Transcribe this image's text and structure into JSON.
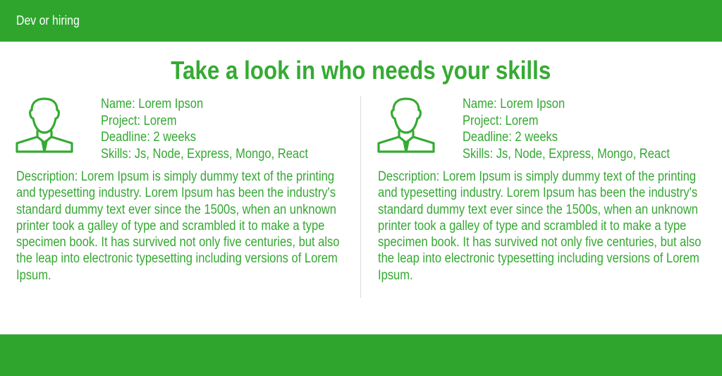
{
  "header": {
    "brand": "Dev or hiring"
  },
  "main": {
    "headline": "Take a look in who needs your skills",
    "cards": [
      {
        "icon": "user-avatar-icon",
        "name": "Name: Lorem Ipson",
        "project": "Project: Lorem",
        "deadline": "Deadline: 2 weeks",
        "skills": "Skills: Js, Node, Express, Mongo, React",
        "description": "Description:  Lorem Ipsum is simply dummy text of the printing and typesetting industry. Lorem Ipsum has been the industry's standard dummy text ever since the 1500s, when an unknown printer took a galley of type and scrambled it to make a type specimen book. It has survived not only five centuries, but also the leap into electronic typesetting including versions of Lorem Ipsum."
      },
      {
        "icon": "user-avatar-icon",
        "name": "Name: Lorem Ipson",
        "project": "Project: Lorem",
        "deadline": "Deadline: 2 weeks",
        "skills": "Skills: Js, Node, Express, Mongo, React",
        "description": "Description:  Lorem Ipsum is simply dummy text of the printing and typesetting industry. Lorem Ipsum has been the industry's standard dummy text ever since the 1500s, when an unknown printer took a galley of type and scrambled it to make a type specimen book. It has survived not only five centuries, but also the leap into electronic typesetting including versions of Lorem Ipsum."
      }
    ]
  },
  "colors": {
    "brand_green": "#2fa52e",
    "text_green": "#34a832",
    "background": "#ffffff"
  }
}
